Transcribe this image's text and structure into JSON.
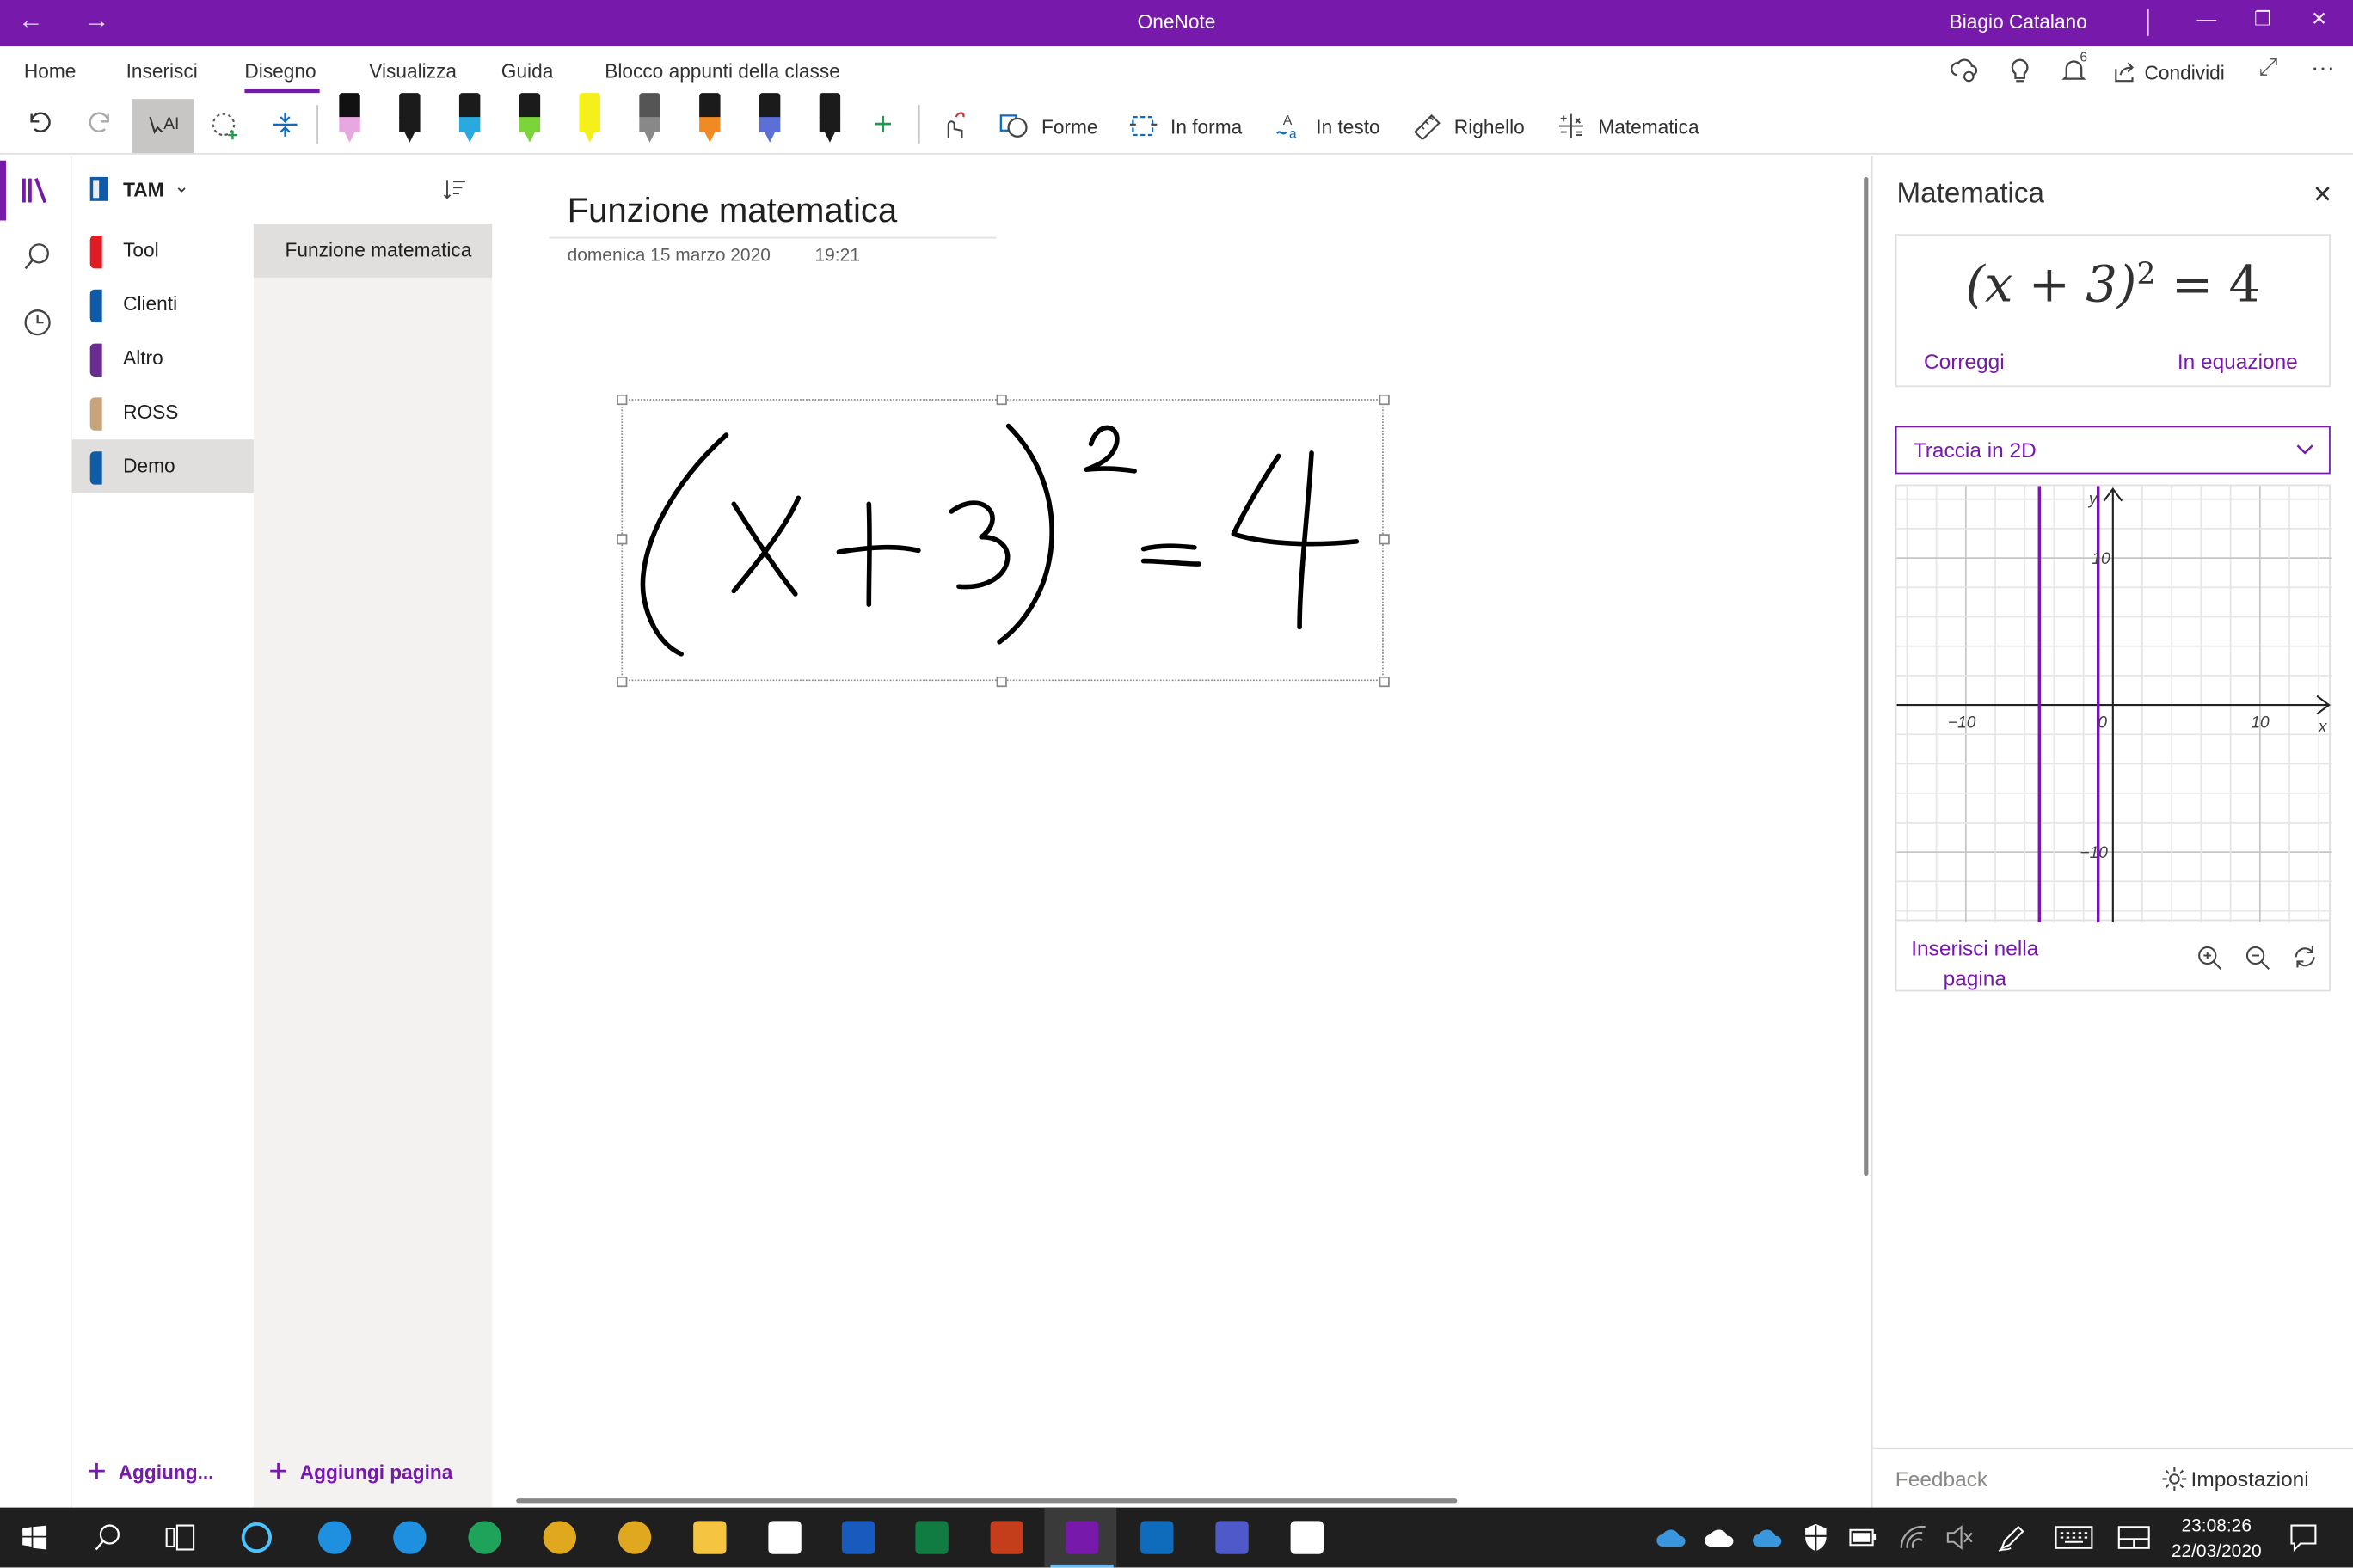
{
  "app": {
    "title": "OneNote",
    "user": "Biagio Catalano",
    "accent": "#7719aa"
  },
  "ribbon": {
    "tabs": [
      {
        "label": "Home"
      },
      {
        "label": "Inserisci"
      },
      {
        "label": "Disegno",
        "active": true
      },
      {
        "label": "Visualizza"
      },
      {
        "label": "Guida"
      },
      {
        "label": "Blocco appunti della classe"
      }
    ],
    "share_label": "Condividi",
    "notification_count": "6"
  },
  "toolbar": {
    "pens": [
      {
        "name": "highlighter-pink-pen",
        "cap": "#111111",
        "color": "#e7a8e0"
      },
      {
        "name": "black-pen",
        "cap": "#1b1b1b",
        "color": "#1b1b1b"
      },
      {
        "name": "cyan-pen",
        "cap": "#1b1b1b",
        "color": "#2aa9e0"
      },
      {
        "name": "green-pen",
        "cap": "#1b1b1b",
        "color": "#7bd43a"
      },
      {
        "name": "yellow-highlighter",
        "cap": "#f5ef1a",
        "color": "#f5ef1a"
      },
      {
        "name": "galaxy-pen",
        "cap": "#555555",
        "color": "#888888"
      },
      {
        "name": "rainbow-pen",
        "cap": "#1b1b1b",
        "color": "#f08a24"
      },
      {
        "name": "gradient-pen",
        "cap": "#1b1b1b",
        "color": "#5b6fd6"
      },
      {
        "name": "dark-pen",
        "cap": "#1b1b1b",
        "color": "#1b1b1b"
      }
    ],
    "commands": {
      "shapes": "Forme",
      "ink_to_shape": "In forma",
      "ink_to_text": "In testo",
      "ruler": "Righello",
      "math": "Matematica"
    }
  },
  "notebook": {
    "name": "TAM",
    "sections": [
      {
        "label": "Tool",
        "color": "#e01b24"
      },
      {
        "label": "Clienti",
        "color": "#0f5ba8"
      },
      {
        "label": "Altro",
        "color": "#6b2c91"
      },
      {
        "label": "ROSS",
        "color": "#c7a27a"
      },
      {
        "label": "Demo",
        "color": "#0f5ba8",
        "selected": true
      }
    ],
    "pages": [
      {
        "label": "Funzione matematica",
        "selected": true
      }
    ],
    "add_section_label": "Aggiung...",
    "add_page_label": "Aggiungi pagina"
  },
  "page": {
    "title": "Funzione matematica",
    "date": "domenica 15 marzo 2020",
    "time": "19:21",
    "ink_content": "(x+3)²=4"
  },
  "math_pane": {
    "title": "Matematica",
    "equation": "(x + 3)² = 4",
    "equation_base": "(x + 3)",
    "equation_exponent": "2",
    "equation_rhs": " = 4",
    "correct_label": "Correggi",
    "equation_action_label": "In equazione",
    "dropdown_value": "Traccia in 2D",
    "graph": {
      "x_axis_label": "x",
      "y_axis_label": "y",
      "tick_neg_x": "−10",
      "tick_pos_x": "10",
      "tick_origin": "0",
      "tick_pos_y": "10",
      "tick_neg_y": "−10",
      "solutions_x": [
        -5,
        -1
      ],
      "line_color": "#7719aa"
    },
    "insert_label": "Inserisci nella pagina",
    "feedback_label": "Feedback",
    "settings_label": "Impostazioni"
  },
  "taskbar": {
    "time": "23:08:26",
    "date": "22/03/2020"
  }
}
